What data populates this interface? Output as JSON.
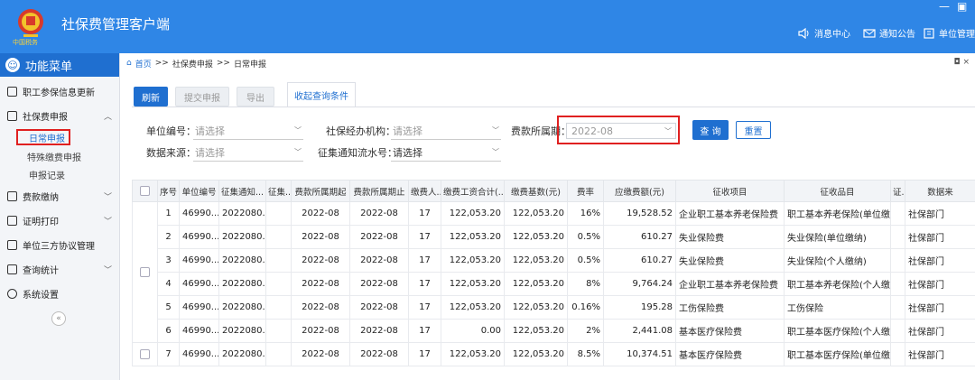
{
  "header": {
    "title": "社保费管理客户端",
    "logo_text": "中国税务",
    "links": [
      {
        "label": "消息中心",
        "icon": "speaker-icon"
      },
      {
        "label": "通知公告",
        "icon": "mail-icon"
      },
      {
        "label": "单位管理",
        "icon": "building-icon"
      }
    ],
    "win_min": "—",
    "win_restore": "▣"
  },
  "sidebar": {
    "title": "功能菜单",
    "items": [
      {
        "label": "职工参保信息更新",
        "chev": ""
      },
      {
        "label": "社保费申报",
        "chev": "︿"
      },
      {
        "label": "费款缴纳",
        "chev": "﹀"
      },
      {
        "label": "证明打印",
        "chev": "﹀"
      },
      {
        "label": "单位三方协议管理",
        "chev": ""
      },
      {
        "label": "查询统计",
        "chev": "﹀"
      },
      {
        "label": "系统设置",
        "chev": ""
      }
    ],
    "sub_items": [
      "日常申报",
      "特殊缴费申报",
      "申报记录"
    ],
    "collapse": "«"
  },
  "breadcrumb": {
    "home": "首页",
    "level1": "社保费申报",
    "level2": "日常申报",
    "sep": ">>",
    "ctrl": "◘ ×"
  },
  "toolbar": {
    "refresh": "刷新",
    "submit": "提交申报",
    "export": "导出",
    "toggle": "收起查询条件"
  },
  "filters": {
    "unit_no_label": "单位编号：",
    "unit_no_placeholder": "请选择",
    "agency_label": "社保经办机构：",
    "agency_placeholder": "请选择",
    "period_label": "费款所属期：",
    "period_value": "2022-08",
    "source_label": "数据来源：",
    "source_placeholder": "请选择",
    "serial_label": "征集通知流水号：",
    "serial_placeholder": "请选择",
    "query": "查 询",
    "reset": "重置"
  },
  "table": {
    "headers": [
      "",
      "序号",
      "单位编号",
      "征集通知...",
      "征集...",
      "费款所属期起",
      "费款所属期止",
      "缴费人...",
      "缴费工资合计(...",
      "缴费基数(元)",
      "费率",
      "应缴费额(元)",
      "征收项目",
      "征收品目",
      "证...",
      "数据来"
    ],
    "rows": [
      [
        "1",
        "46990...",
        "2022080...",
        "",
        "2022-08",
        "2022-08",
        "17",
        "122,053.20",
        "122,053.20",
        "16%",
        "19,528.52",
        "企业职工基本养老保险费",
        "职工基本养老保险(单位缴纳)",
        "",
        "社保部门"
      ],
      [
        "2",
        "46990...",
        "2022080...",
        "",
        "2022-08",
        "2022-08",
        "17",
        "122,053.20",
        "122,053.20",
        "0.5%",
        "610.27",
        "失业保险费",
        "失业保险(单位缴纳)",
        "",
        "社保部门"
      ],
      [
        "3",
        "46990...",
        "2022080...",
        "",
        "2022-08",
        "2022-08",
        "17",
        "122,053.20",
        "122,053.20",
        "0.5%",
        "610.27",
        "失业保险费",
        "失业保险(个人缴纳)",
        "",
        "社保部门"
      ],
      [
        "4",
        "46990...",
        "2022080...",
        "",
        "2022-08",
        "2022-08",
        "17",
        "122,053.20",
        "122,053.20",
        "8%",
        "9,764.24",
        "企业职工基本养老保险费",
        "职工基本养老保险(个人缴纳)",
        "",
        "社保部门"
      ],
      [
        "5",
        "46990...",
        "2022080...",
        "",
        "2022-08",
        "2022-08",
        "17",
        "122,053.20",
        "122,053.20",
        "0.16%",
        "195.28",
        "工伤保险费",
        "工伤保险",
        "",
        "社保部门"
      ],
      [
        "6",
        "46990...",
        "2022080...",
        "",
        "2022-08",
        "2022-08",
        "17",
        "0.00",
        "122,053.20",
        "2%",
        "2,441.08",
        "基本医疗保险费",
        "职工基本医疗保险(个人缴纳)",
        "",
        "社保部门"
      ],
      [
        "7",
        "46990...",
        "2022080...",
        "",
        "2022-08",
        "2022-08",
        "17",
        "122,053.20",
        "122,053.20",
        "8.5%",
        "10,374.51",
        "基本医疗保险费",
        "职工基本医疗保险(单位缴纳)",
        "",
        "社保部门"
      ]
    ]
  }
}
